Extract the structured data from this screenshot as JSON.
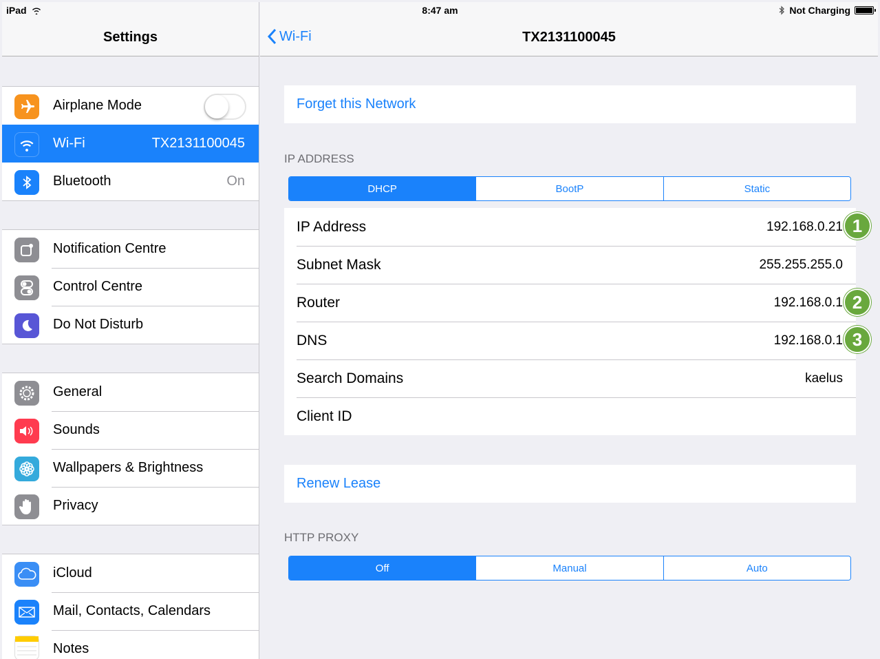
{
  "status_bar": {
    "device": "iPad",
    "time": "8:47 am",
    "charging": "Not Charging"
  },
  "sidebar": {
    "title": "Settings",
    "groups": [
      [
        {
          "label": "Airplane Mode",
          "icon": "airplane-icon",
          "color": "#f7931e",
          "control": "toggle-off"
        },
        {
          "label": "Wi-Fi",
          "value": "TX2131100045",
          "icon": "wifi-icon",
          "color": "#1a82fb",
          "selected": true
        },
        {
          "label": "Bluetooth",
          "value": "On",
          "icon": "bluetooth-icon",
          "color": "#1a82fb"
        }
      ],
      [
        {
          "label": "Notification Centre",
          "icon": "notification-icon",
          "color": "#8e8e93"
        },
        {
          "label": "Control Centre",
          "icon": "control-centre-icon",
          "color": "#8e8e93"
        },
        {
          "label": "Do Not Disturb",
          "icon": "moon-icon",
          "color": "#5856d6"
        }
      ],
      [
        {
          "label": "General",
          "icon": "gear-icon",
          "color": "#8e8e93"
        },
        {
          "label": "Sounds",
          "icon": "speaker-icon",
          "color": "#ff3b4f"
        },
        {
          "label": "Wallpapers & Brightness",
          "icon": "flower-icon",
          "color": "#34aadc"
        },
        {
          "label": "Privacy",
          "icon": "hand-icon",
          "color": "#8e8e93"
        }
      ],
      [
        {
          "label": "iCloud",
          "icon": "cloud-icon",
          "color": "#3a8ef5"
        },
        {
          "label": "Mail, Contacts, Calendars",
          "icon": "mail-icon",
          "color": "#1a82fb"
        },
        {
          "label": "Notes",
          "icon": "notes-icon",
          "color": "#ffcc00"
        }
      ]
    ]
  },
  "detail": {
    "back_label": "Wi-Fi",
    "title": "TX2131100045",
    "forget_label": "Forget this Network",
    "ip_section_label": "IP ADDRESS",
    "ip_modes": [
      "DHCP",
      "BootP",
      "Static"
    ],
    "ip_mode_selected": 0,
    "rows": [
      {
        "key": "IP Address",
        "value": "192.168.0.21",
        "badge": "1"
      },
      {
        "key": "Subnet Mask",
        "value": "255.255.255.0"
      },
      {
        "key": "Router",
        "value": "192.168.0.1",
        "badge": "2"
      },
      {
        "key": "DNS",
        "value": "192.168.0.1",
        "badge": "3"
      },
      {
        "key": "Search Domains",
        "value": "kaelus"
      },
      {
        "key": "Client ID",
        "value": ""
      }
    ],
    "renew_label": "Renew Lease",
    "proxy_section_label": "HTTP PROXY",
    "proxy_modes": [
      "Off",
      "Manual",
      "Auto"
    ],
    "proxy_mode_selected": 0
  }
}
